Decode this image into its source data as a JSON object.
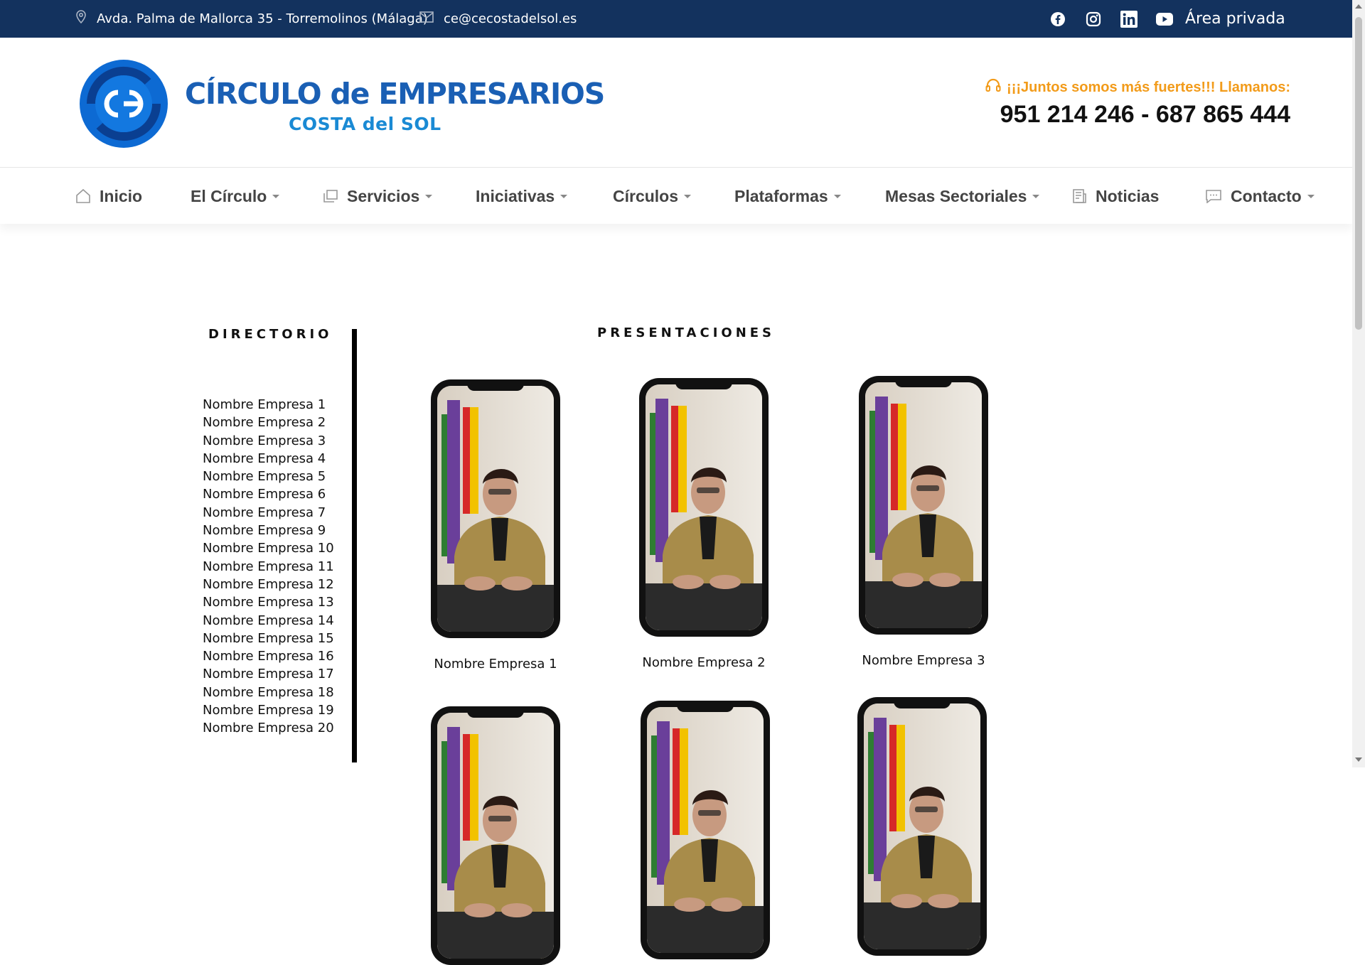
{
  "topbar": {
    "address": "Avda. Palma de Mallorca 35 - Torremolinos (Málaga)",
    "email": "ce@cecostadelsol.es",
    "socials": [
      "facebook-icon",
      "instagram-icon",
      "linkedin-icon",
      "youtube-icon"
    ],
    "private_area": "Área privada"
  },
  "header": {
    "logo_title": "CÍRCULO de EMPRESARIOS",
    "logo_subtitle": "COSTA del SOL",
    "slogan": "¡¡¡Juntos somos más fuertes!!! Llamanos:",
    "phones": "951 214 246 - 687 865 444"
  },
  "nav": {
    "items": [
      {
        "label": "Inicio",
        "icon": "home-icon",
        "dropdown": false
      },
      {
        "label": "El Círculo",
        "icon": "",
        "dropdown": true
      },
      {
        "label": "Servicios",
        "icon": "services-icon",
        "dropdown": true
      },
      {
        "label": "Iniciativas",
        "icon": "",
        "dropdown": true
      },
      {
        "label": "Círculos",
        "icon": "",
        "dropdown": true
      },
      {
        "label": "Plataformas",
        "icon": "",
        "dropdown": true
      },
      {
        "label": "Mesas Sectoriales",
        "icon": "",
        "dropdown": true
      },
      {
        "label": "Noticias",
        "icon": "news-icon",
        "dropdown": false
      },
      {
        "label": "Contacto",
        "icon": "chat-icon",
        "dropdown": true
      }
    ]
  },
  "directory": {
    "title": "DIRECTORIO",
    "items": [
      "Nombre Empresa 1",
      "Nombre Empresa 2",
      "Nombre Empresa 3",
      "Nombre Empresa 4",
      "Nombre Empresa 5",
      "Nombre Empresa 6",
      "Nombre Empresa 7",
      "Nombre Empresa 9",
      "Nombre Empresa 10",
      "Nombre Empresa 11",
      "Nombre Empresa 12",
      "Nombre Empresa 13",
      "Nombre Empresa 14",
      "Nombre Empresa 15",
      "Nombre Empresa 16",
      "Nombre Empresa 17",
      "Nombre Empresa 18",
      "Nombre Empresa 19",
      "Nombre Empresa 20"
    ]
  },
  "presentations": {
    "title": "PRESENTACIONES",
    "cards": [
      {
        "label": "Nombre Empresa 1"
      },
      {
        "label": "Nombre Empresa 2"
      },
      {
        "label": "Nombre Empresa 3"
      },
      {
        "label": ""
      },
      {
        "label": ""
      },
      {
        "label": ""
      }
    ]
  },
  "colors": {
    "topbar": "#13325e",
    "brand_blue": "#1a5fb4",
    "accent_orange": "#f29b1a"
  }
}
